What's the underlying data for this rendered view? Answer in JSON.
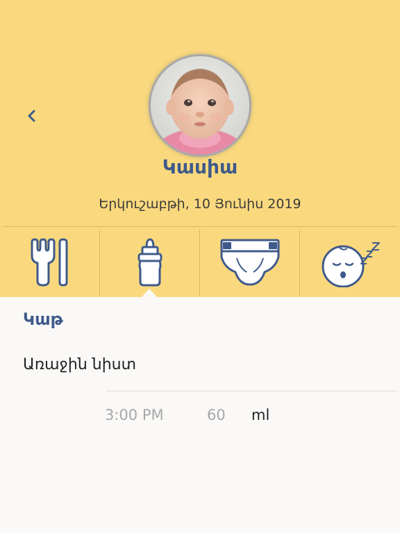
{
  "header": {
    "back_icon": "chevron-left-icon",
    "avatar_icon": "baby-photo",
    "baby_name": "Կասիա",
    "date": "Երկուշաբթի, 10 Յունիս 2019",
    "background_color": "#fad97e",
    "accent_color": "#3f5a8a"
  },
  "tabs": [
    {
      "icon": "utensils-icon",
      "selected": false
    },
    {
      "icon": "baby-bottle-icon",
      "selected": true
    },
    {
      "icon": "diaper-icon",
      "selected": false
    },
    {
      "icon": "sleeping-baby-icon",
      "selected": false
    }
  ],
  "content": {
    "section_title": "Կաթ",
    "session_label": "Առաջին նիստ",
    "time": "3:00 PM",
    "amount": "60",
    "unit": "ml"
  }
}
